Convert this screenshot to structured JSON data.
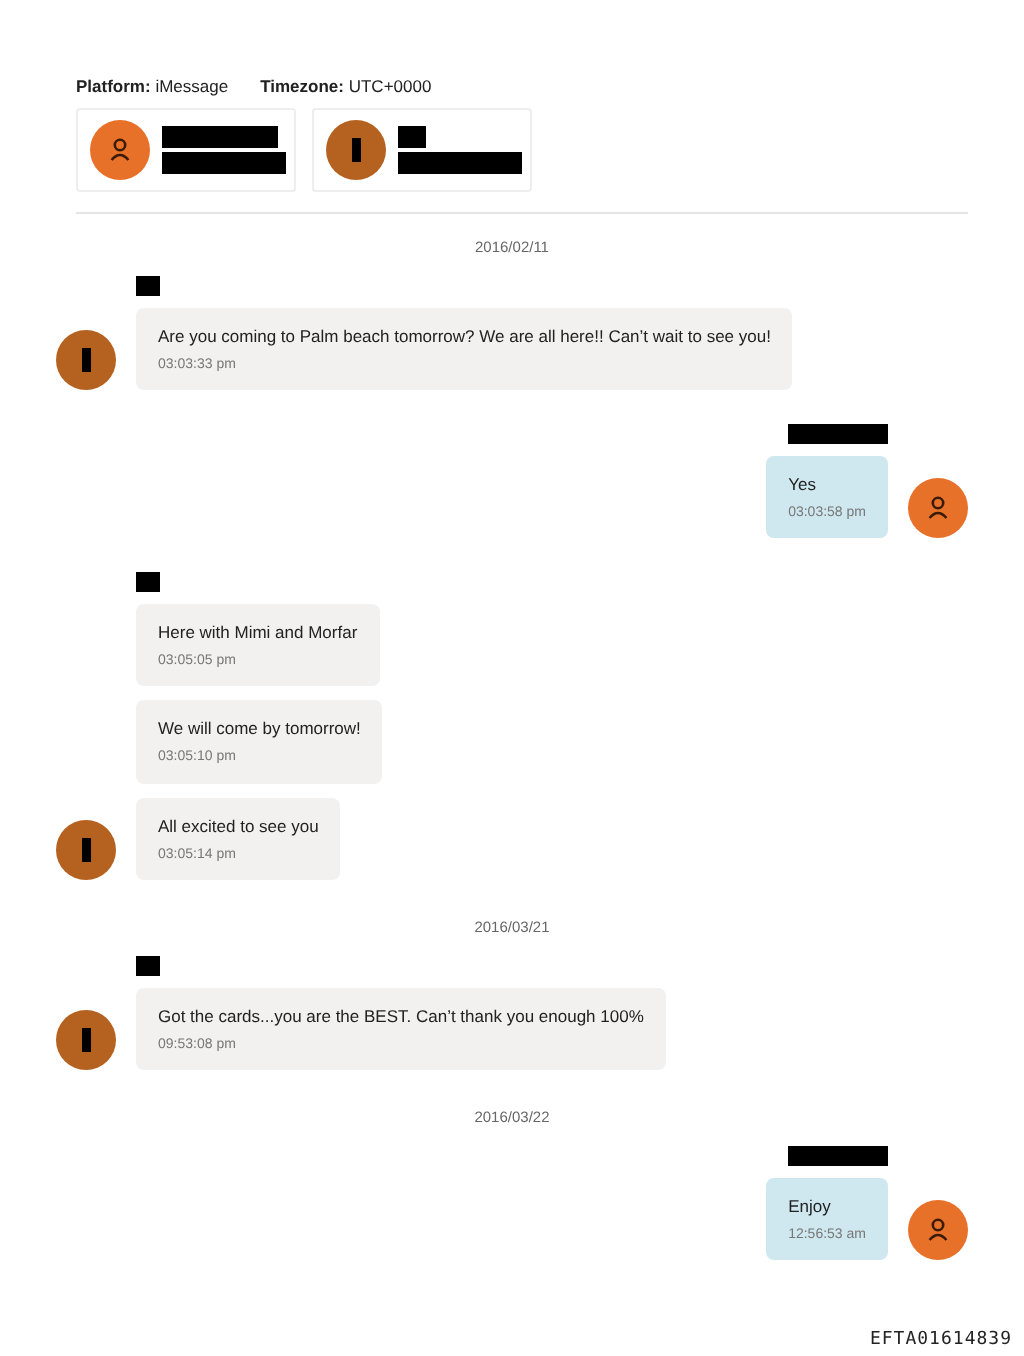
{
  "header": {
    "fields": [
      {
        "label": "Platform:",
        "value": "iMessage"
      },
      {
        "label": "Timezone:",
        "value": "UTC+0000"
      }
    ]
  },
  "participants": [
    {
      "kind": "user"
    },
    {
      "kind": "contact"
    }
  ],
  "timeline": [
    {
      "kind": "date",
      "text": "2016/02/11"
    },
    {
      "kind": "group",
      "outgoing": false,
      "messages": [
        {
          "text": "Are you coming to Palm beach tomorrow? We are all here!! Can’t wait to see you!",
          "time": "03:03:33 pm"
        }
      ]
    },
    {
      "kind": "group",
      "outgoing": true,
      "messages": [
        {
          "text": "Yes",
          "time": "03:03:58 pm"
        }
      ]
    },
    {
      "kind": "group",
      "outgoing": false,
      "messages": [
        {
          "text": "Here with Mimi and Morfar",
          "time": "03:05:05 pm"
        },
        {
          "text": "We will come by tomorrow!",
          "time": "03:05:10 pm"
        },
        {
          "text": "All excited to see you",
          "time": "03:05:14 pm"
        }
      ]
    },
    {
      "kind": "date",
      "text": "2016/03/21"
    },
    {
      "kind": "group",
      "outgoing": false,
      "messages": [
        {
          "text": "Got the cards...you are the BEST. Can’t thank you enough 100%",
          "time": "09:53:08 pm"
        }
      ]
    },
    {
      "kind": "date",
      "text": "2016/03/22"
    },
    {
      "kind": "group",
      "outgoing": true,
      "messages": [
        {
          "text": "Enjoy",
          "time": "12:56:53 am"
        }
      ]
    }
  ],
  "stamp": "EFTA01614839"
}
